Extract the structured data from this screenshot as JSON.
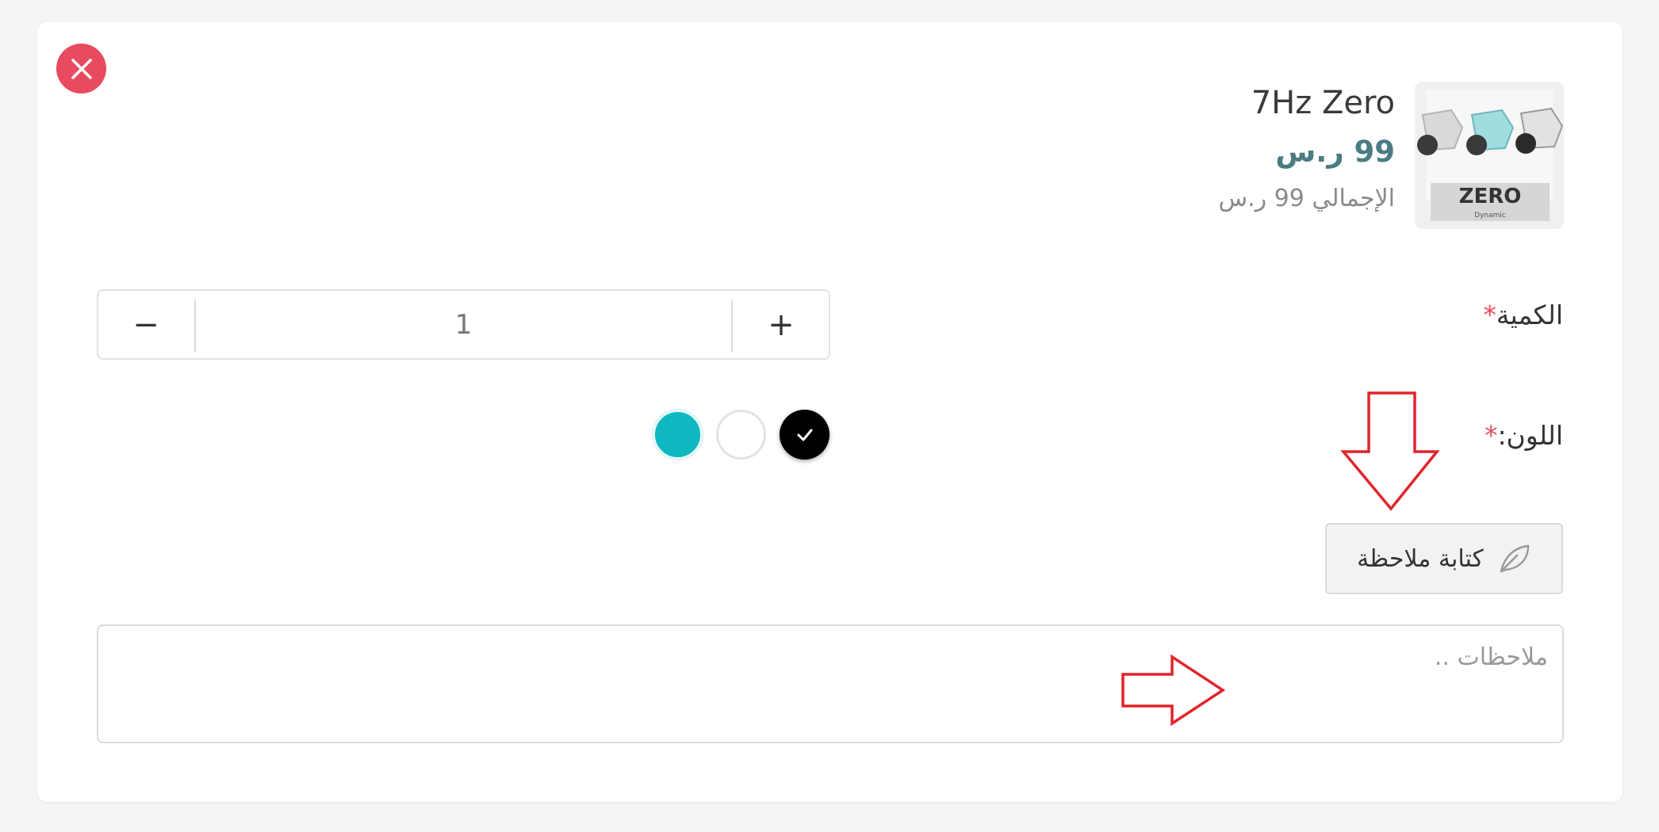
{
  "product": {
    "name": "7Hz Zero",
    "price": "99 ر.س",
    "total": "الإجمالي 99 ر.س",
    "image_text": "ZERO",
    "image_subtext": "Dynamic"
  },
  "quantity": {
    "label": "الكمية",
    "required_mark": "*",
    "value": "1",
    "minus_glyph": "−",
    "plus_glyph": "+"
  },
  "color": {
    "label": "اللون:",
    "required_mark": "*",
    "options": [
      {
        "name": "black",
        "hex": "#000000",
        "selected": true
      },
      {
        "name": "white",
        "hex": "#ffffff",
        "selected": false
      },
      {
        "name": "teal",
        "hex": "#0fb8c1",
        "selected": false
      }
    ]
  },
  "note": {
    "button_label": "كتابة ملاحظة",
    "button_icon": "feather-icon",
    "placeholder": "ملاحظات .."
  },
  "colors": {
    "close": "#e84a5f",
    "price": "#4a7c82",
    "required": "#e84a5f",
    "annotation_arrow": "#e0242b"
  }
}
